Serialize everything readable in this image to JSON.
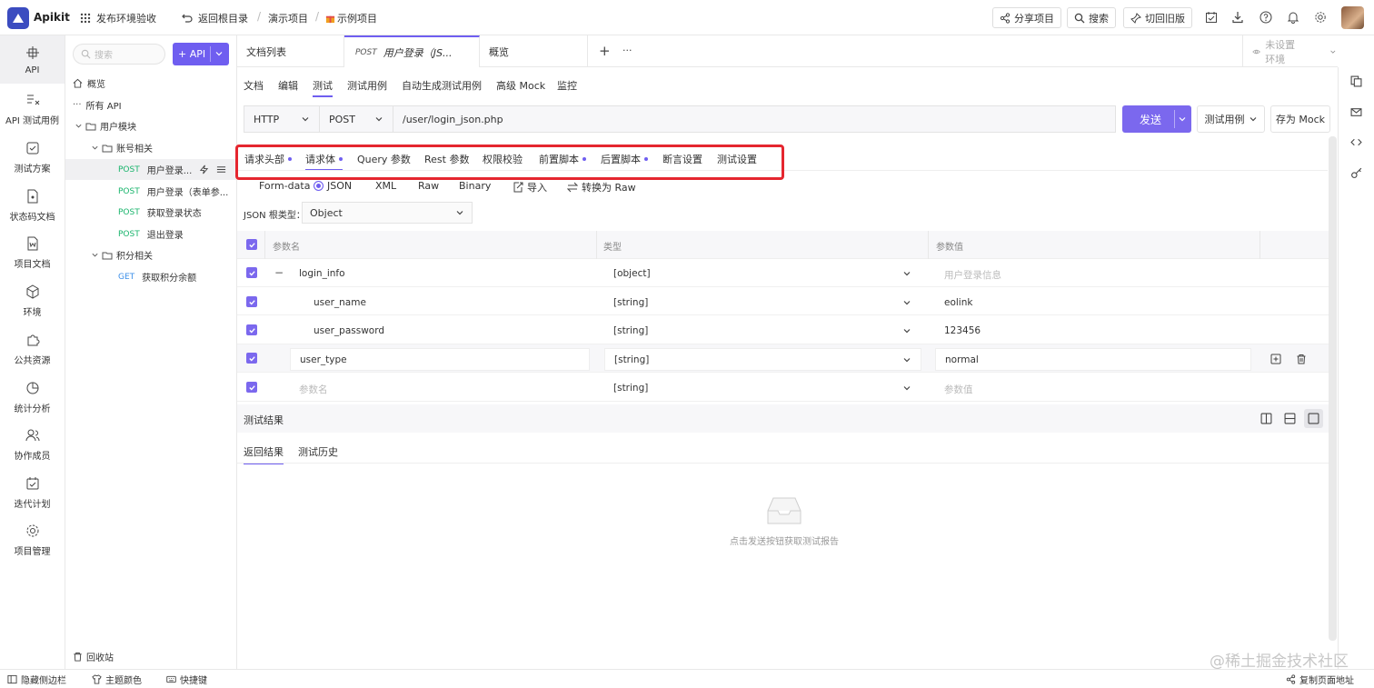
{
  "header": {
    "brand": "Apikit",
    "workspace": "发布环境验收",
    "back_to_root": "返回根目录",
    "breadcrumb_group": "演示项目",
    "breadcrumb_project": "示例项目",
    "share_label": "分享项目",
    "search_label": "搜索",
    "switch_old_label": "切回旧版"
  },
  "rail": {
    "items": [
      "API",
      "API 测试用例",
      "测试方案",
      "状态码文档",
      "项目文档",
      "环境",
      "公共资源",
      "统计分析",
      "协作成员",
      "迭代计划",
      "项目管理"
    ]
  },
  "tree": {
    "search_placeholder": "搜索",
    "add_api_label": "+ API",
    "overview": "概览",
    "all_api": "所有 API",
    "groups": {
      "user_module": "用户模块",
      "account": "账号相关",
      "points": "积分相关"
    },
    "apis": [
      {
        "method": "POST",
        "name": "用户登录..."
      },
      {
        "method": "POST",
        "name": "用户登录（表单参..."
      },
      {
        "method": "POST",
        "name": "获取登录状态"
      },
      {
        "method": "POST",
        "name": "退出登录"
      },
      {
        "method": "GET",
        "name": "获取积分余额"
      }
    ],
    "recycle": "回收站"
  },
  "tabs": {
    "doc_list": "文档列表",
    "active_method": "POST",
    "active_name": "用户登录（JS...",
    "overview": "概览",
    "add": "+",
    "more": "···",
    "env": "未设置环境"
  },
  "subtabs": [
    "文档",
    "编辑",
    "测试",
    "测试用例",
    "自动生成测试用例",
    "高级 Mock",
    "监控"
  ],
  "request": {
    "protocol": "HTTP",
    "method": "POST",
    "url": "/user/login_json.php",
    "send": "发送",
    "test_case": "测试用例",
    "save_mock": "存为 Mock"
  },
  "param_tabs": [
    "请求头部",
    "请求体",
    "Query 参数",
    "Rest 参数",
    "权限校验",
    "前置脚本",
    "后置脚本",
    "断言设置",
    "测试设置"
  ],
  "body_types": [
    "Form-data",
    "JSON",
    "XML",
    "Raw",
    "Binary"
  ],
  "body_selected": "JSON",
  "import_label": "导入",
  "convert_raw_label": "转换为 Raw",
  "json_root_label": "JSON 根类型：",
  "json_root_value": "Object",
  "table": {
    "headers": [
      "参数名",
      "类型",
      "参数值"
    ],
    "rows": [
      {
        "name": "login_info",
        "type": "[object]",
        "value": "用户登录信息"
      },
      {
        "name": "user_name",
        "type": "[string]",
        "value": "eolink"
      },
      {
        "name": "user_password",
        "type": "[string]",
        "value": "123456"
      },
      {
        "name": "user_type",
        "type": "[string]",
        "value": "normal"
      },
      {
        "name": "参数名",
        "type": "[string]",
        "value": "参数值"
      }
    ]
  },
  "results": {
    "title": "测试结果",
    "tab_return": "返回结果",
    "tab_history": "测试历史",
    "empty_text": "点击发送按钮获取测试报告"
  },
  "footer": {
    "hide_sidebar": "隐藏侧边栏",
    "theme": "主题颜色",
    "shortcuts": "快捷键",
    "copy_url": "复制页面地址"
  },
  "watermark": "@稀土掘金技术社区",
  "colors": {
    "accent": "#6f5ef0",
    "post": "#19b46c",
    "get": "#3c8fe8",
    "highlight_box": "#e5262f"
  }
}
